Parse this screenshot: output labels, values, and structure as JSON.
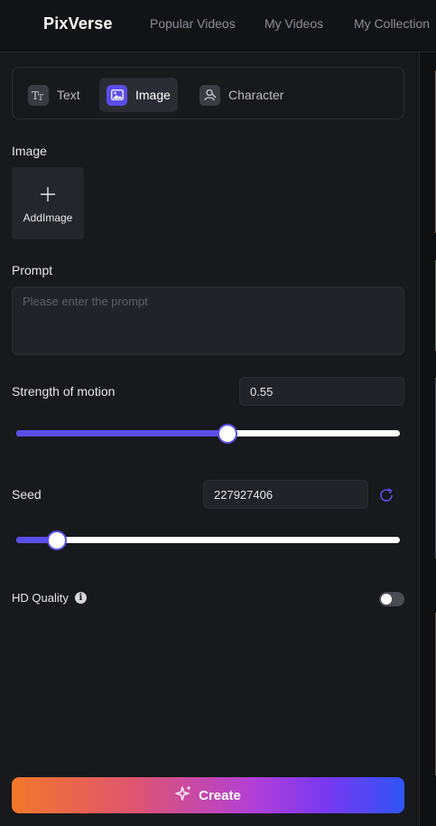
{
  "header": {
    "logo": "PixVerse",
    "nav": [
      "Popular Videos",
      "My Videos",
      "My Collection"
    ]
  },
  "tabs": [
    {
      "label": "Text",
      "icon": "text-icon",
      "active": false
    },
    {
      "label": "Image",
      "icon": "image-icon",
      "active": true
    },
    {
      "label": "Character",
      "icon": "character-icon",
      "active": false
    }
  ],
  "image_section": {
    "label": "Image",
    "add_label": "AddImage"
  },
  "prompt": {
    "label": "Prompt",
    "placeholder": "Please enter the prompt",
    "value": ""
  },
  "motion": {
    "label": "Strength of motion",
    "value": "0.55",
    "slider_fraction": 0.55
  },
  "seed": {
    "label": "Seed",
    "value": "227927406",
    "slider_fraction": 0.105
  },
  "hd": {
    "label": "HD Quality",
    "enabled": false
  },
  "create": {
    "label": "Create"
  },
  "colors": {
    "accent": "#5b4ee8",
    "background": "#18191c",
    "create_gradient": [
      "#f3772a",
      "#b13fd8",
      "#2f55f6"
    ]
  }
}
